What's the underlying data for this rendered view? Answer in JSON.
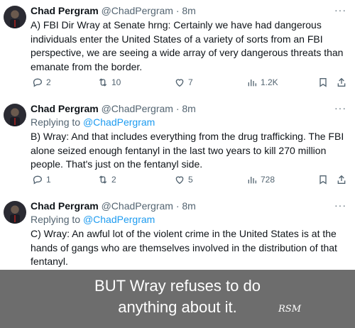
{
  "tweets": [
    {
      "name": "Chad Pergram",
      "handle_time": "@ChadPergram · 8m",
      "replying_prefix": "",
      "replying_handle": "",
      "text": "A) FBI Dir Wray at Senate hrng: Certainly we have had dangerous individuals enter the United States of a variety of sorts from an FBI perspective, we are seeing a wide array of very dangerous threats than emanate from the border.",
      "replies": "2",
      "retweets": "10",
      "likes": "7",
      "views": "1.2K"
    },
    {
      "name": "Chad Pergram",
      "handle_time": "@ChadPergram · 8m",
      "replying_prefix": "Replying to ",
      "replying_handle": "@ChadPergram",
      "text": "B) Wray: And that includes everything from the drug trafficking. The FBI alone seized enough fentanyl in the last two years to kill 270 million people. That's just on the fentanyl side.",
      "replies": "1",
      "retweets": "2",
      "likes": "5",
      "views": "728"
    },
    {
      "name": "Chad Pergram",
      "handle_time": "@ChadPergram · 8m",
      "replying_prefix": "Replying to ",
      "replying_handle": "@ChadPergram",
      "text": "C) Wray: An awful lot of the violent crime in the United States is at the hands of gangs who are themselves involved in the distribution of that fentanyl."
    }
  ],
  "more_label": "···",
  "caption": {
    "line1": "BUT Wray refuses to do",
    "line2": "anything about it.",
    "signature": "RSM"
  }
}
